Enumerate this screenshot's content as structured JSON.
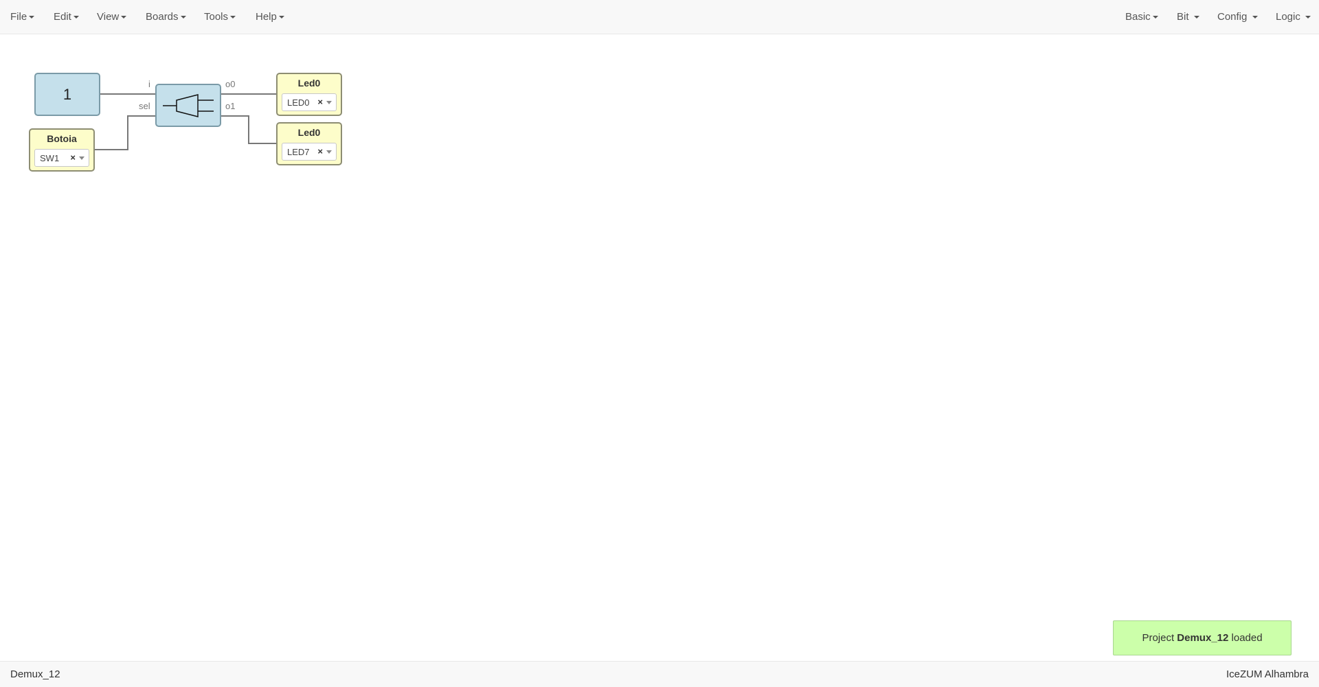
{
  "menubar": {
    "left": [
      {
        "label": "File"
      },
      {
        "label": "Edit"
      },
      {
        "label": "View"
      },
      {
        "label": "Boards"
      },
      {
        "label": "Tools"
      },
      {
        "label": "Help"
      }
    ],
    "right": [
      {
        "label": "Basic"
      },
      {
        "label": "Bit"
      },
      {
        "label": "Config"
      },
      {
        "label": "Logic"
      }
    ]
  },
  "canvas": {
    "constant_block": {
      "value": "1"
    },
    "input_block": {
      "title": "Botoia",
      "pin": "SW1",
      "clear": "×"
    },
    "demux_block": {
      "icon": "demux-icon",
      "ports": {
        "in": "i",
        "sel": "sel",
        "out0": "o0",
        "out1": "o1"
      }
    },
    "output_blocks": [
      {
        "title": "Led0",
        "pin": "LED0",
        "clear": "×"
      },
      {
        "title": "Led0",
        "pin": "LED7",
        "clear": "×"
      }
    ],
    "colors": {
      "block_blue": "#c5e0eb",
      "block_yellow": "#fdfdca",
      "wire": "#777777"
    }
  },
  "toast": {
    "prefix": "Project",
    "project": "Demux_12",
    "suffix": "loaded",
    "color": "#ccffaa"
  },
  "footer": {
    "project_name": "Demux_12",
    "board_name": "IceZUM Alhambra"
  }
}
